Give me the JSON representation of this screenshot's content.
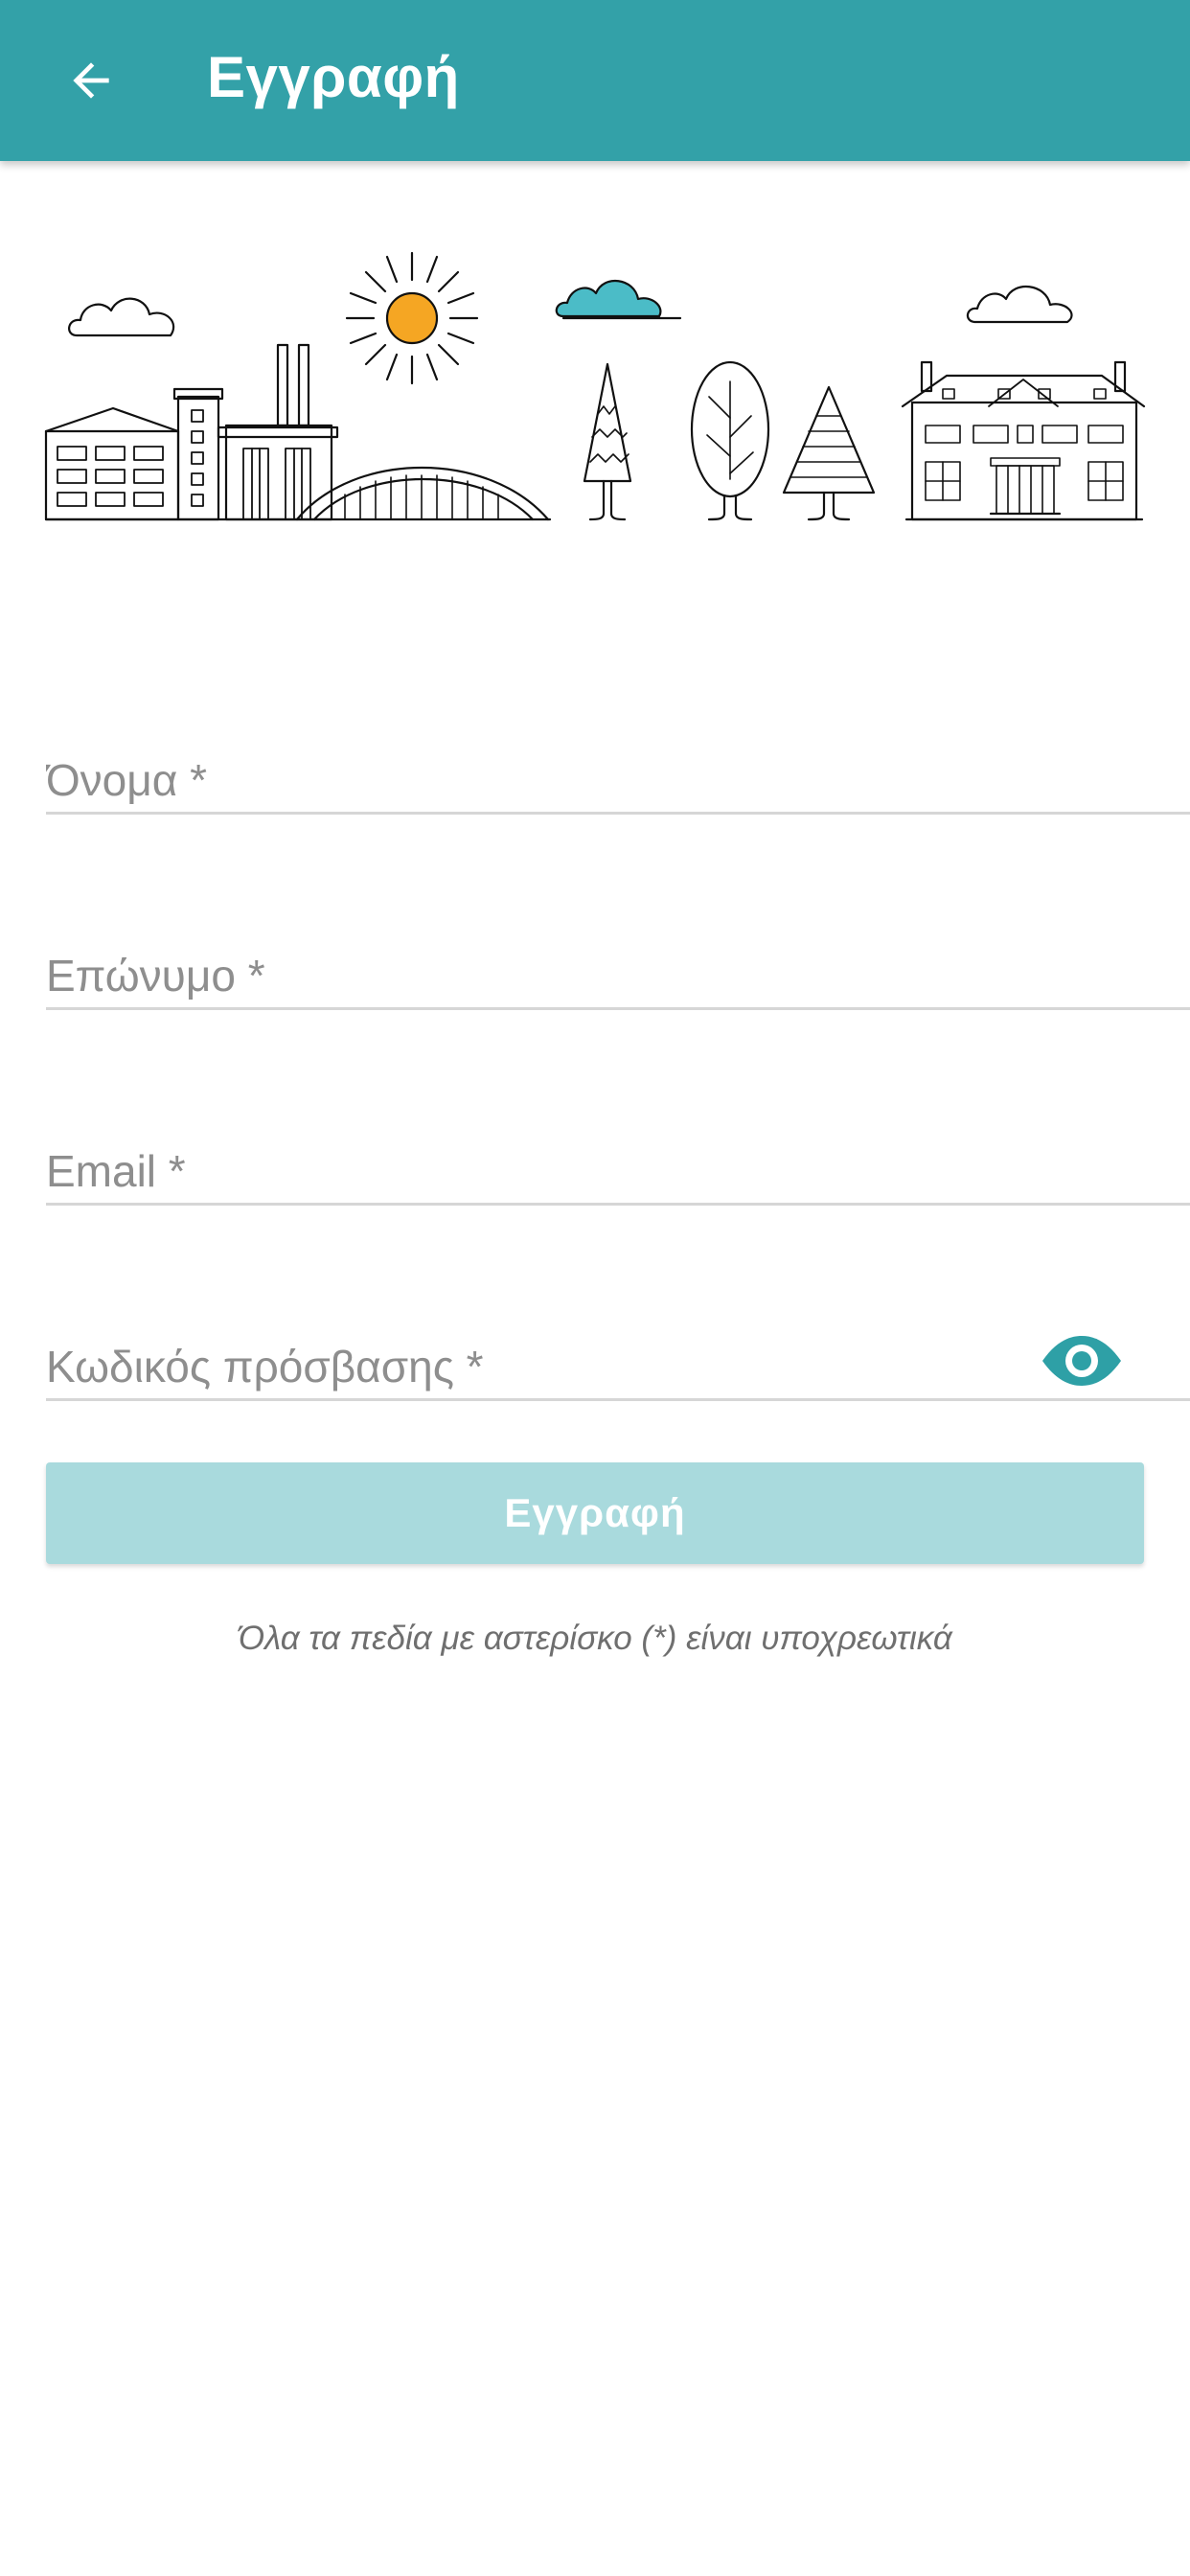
{
  "header": {
    "title": "Εγγραφή",
    "back_icon": "arrow-back-icon",
    "background": "#33a1a8"
  },
  "illustration": {
    "name": "city-nature-illustration",
    "sun_color": "#f5a623",
    "accent_cloud_color": "#4bbcc7"
  },
  "form": {
    "first_name": {
      "placeholder": "Όνομα *",
      "value": ""
    },
    "last_name": {
      "placeholder": "Επώνυμο *",
      "value": ""
    },
    "email": {
      "placeholder": "Email *",
      "value": ""
    },
    "password": {
      "placeholder": "Κωδικός πρόσβασης *",
      "value": "",
      "toggle_icon": "eye-icon"
    },
    "submit_label": "Εγγραφή",
    "submit_color": "#a9dadd",
    "required_note": "Όλα τα πεδία με αστερίσκο (*) είναι υποχρεωτικά"
  }
}
